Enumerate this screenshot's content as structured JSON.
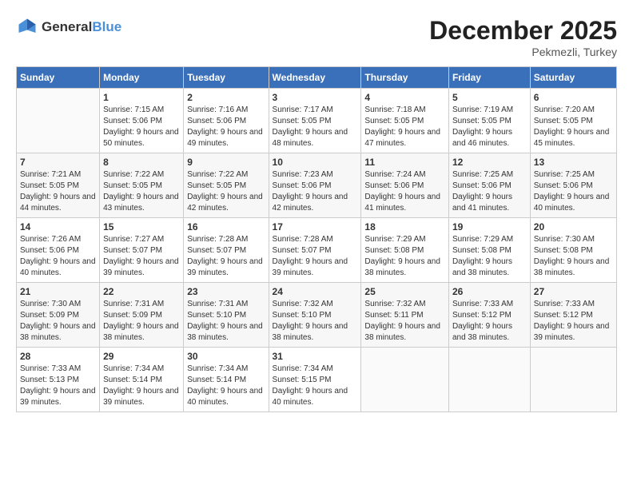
{
  "logo": {
    "general": "General",
    "blue": "Blue"
  },
  "title": "December 2025",
  "location": "Pekmezli, Turkey",
  "days_header": [
    "Sunday",
    "Monday",
    "Tuesday",
    "Wednesday",
    "Thursday",
    "Friday",
    "Saturday"
  ],
  "weeks": [
    [
      {
        "day": "",
        "sunrise": "",
        "sunset": "",
        "daylight": ""
      },
      {
        "day": "1",
        "sunrise": "Sunrise: 7:15 AM",
        "sunset": "Sunset: 5:06 PM",
        "daylight": "Daylight: 9 hours and 50 minutes."
      },
      {
        "day": "2",
        "sunrise": "Sunrise: 7:16 AM",
        "sunset": "Sunset: 5:06 PM",
        "daylight": "Daylight: 9 hours and 49 minutes."
      },
      {
        "day": "3",
        "sunrise": "Sunrise: 7:17 AM",
        "sunset": "Sunset: 5:05 PM",
        "daylight": "Daylight: 9 hours and 48 minutes."
      },
      {
        "day": "4",
        "sunrise": "Sunrise: 7:18 AM",
        "sunset": "Sunset: 5:05 PM",
        "daylight": "Daylight: 9 hours and 47 minutes."
      },
      {
        "day": "5",
        "sunrise": "Sunrise: 7:19 AM",
        "sunset": "Sunset: 5:05 PM",
        "daylight": "Daylight: 9 hours and 46 minutes."
      },
      {
        "day": "6",
        "sunrise": "Sunrise: 7:20 AM",
        "sunset": "Sunset: 5:05 PM",
        "daylight": "Daylight: 9 hours and 45 minutes."
      }
    ],
    [
      {
        "day": "7",
        "sunrise": "Sunrise: 7:21 AM",
        "sunset": "Sunset: 5:05 PM",
        "daylight": "Daylight: 9 hours and 44 minutes."
      },
      {
        "day": "8",
        "sunrise": "Sunrise: 7:22 AM",
        "sunset": "Sunset: 5:05 PM",
        "daylight": "Daylight: 9 hours and 43 minutes."
      },
      {
        "day": "9",
        "sunrise": "Sunrise: 7:22 AM",
        "sunset": "Sunset: 5:05 PM",
        "daylight": "Daylight: 9 hours and 42 minutes."
      },
      {
        "day": "10",
        "sunrise": "Sunrise: 7:23 AM",
        "sunset": "Sunset: 5:06 PM",
        "daylight": "Daylight: 9 hours and 42 minutes."
      },
      {
        "day": "11",
        "sunrise": "Sunrise: 7:24 AM",
        "sunset": "Sunset: 5:06 PM",
        "daylight": "Daylight: 9 hours and 41 minutes."
      },
      {
        "day": "12",
        "sunrise": "Sunrise: 7:25 AM",
        "sunset": "Sunset: 5:06 PM",
        "daylight": "Daylight: 9 hours and 41 minutes."
      },
      {
        "day": "13",
        "sunrise": "Sunrise: 7:25 AM",
        "sunset": "Sunset: 5:06 PM",
        "daylight": "Daylight: 9 hours and 40 minutes."
      }
    ],
    [
      {
        "day": "14",
        "sunrise": "Sunrise: 7:26 AM",
        "sunset": "Sunset: 5:06 PM",
        "daylight": "Daylight: 9 hours and 40 minutes."
      },
      {
        "day": "15",
        "sunrise": "Sunrise: 7:27 AM",
        "sunset": "Sunset: 5:07 PM",
        "daylight": "Daylight: 9 hours and 39 minutes."
      },
      {
        "day": "16",
        "sunrise": "Sunrise: 7:28 AM",
        "sunset": "Sunset: 5:07 PM",
        "daylight": "Daylight: 9 hours and 39 minutes."
      },
      {
        "day": "17",
        "sunrise": "Sunrise: 7:28 AM",
        "sunset": "Sunset: 5:07 PM",
        "daylight": "Daylight: 9 hours and 39 minutes."
      },
      {
        "day": "18",
        "sunrise": "Sunrise: 7:29 AM",
        "sunset": "Sunset: 5:08 PM",
        "daylight": "Daylight: 9 hours and 38 minutes."
      },
      {
        "day": "19",
        "sunrise": "Sunrise: 7:29 AM",
        "sunset": "Sunset: 5:08 PM",
        "daylight": "Daylight: 9 hours and 38 minutes."
      },
      {
        "day": "20",
        "sunrise": "Sunrise: 7:30 AM",
        "sunset": "Sunset: 5:08 PM",
        "daylight": "Daylight: 9 hours and 38 minutes."
      }
    ],
    [
      {
        "day": "21",
        "sunrise": "Sunrise: 7:30 AM",
        "sunset": "Sunset: 5:09 PM",
        "daylight": "Daylight: 9 hours and 38 minutes."
      },
      {
        "day": "22",
        "sunrise": "Sunrise: 7:31 AM",
        "sunset": "Sunset: 5:09 PM",
        "daylight": "Daylight: 9 hours and 38 minutes."
      },
      {
        "day": "23",
        "sunrise": "Sunrise: 7:31 AM",
        "sunset": "Sunset: 5:10 PM",
        "daylight": "Daylight: 9 hours and 38 minutes."
      },
      {
        "day": "24",
        "sunrise": "Sunrise: 7:32 AM",
        "sunset": "Sunset: 5:10 PM",
        "daylight": "Daylight: 9 hours and 38 minutes."
      },
      {
        "day": "25",
        "sunrise": "Sunrise: 7:32 AM",
        "sunset": "Sunset: 5:11 PM",
        "daylight": "Daylight: 9 hours and 38 minutes."
      },
      {
        "day": "26",
        "sunrise": "Sunrise: 7:33 AM",
        "sunset": "Sunset: 5:12 PM",
        "daylight": "Daylight: 9 hours and 38 minutes."
      },
      {
        "day": "27",
        "sunrise": "Sunrise: 7:33 AM",
        "sunset": "Sunset: 5:12 PM",
        "daylight": "Daylight: 9 hours and 39 minutes."
      }
    ],
    [
      {
        "day": "28",
        "sunrise": "Sunrise: 7:33 AM",
        "sunset": "Sunset: 5:13 PM",
        "daylight": "Daylight: 9 hours and 39 minutes."
      },
      {
        "day": "29",
        "sunrise": "Sunrise: 7:34 AM",
        "sunset": "Sunset: 5:14 PM",
        "daylight": "Daylight: 9 hours and 39 minutes."
      },
      {
        "day": "30",
        "sunrise": "Sunrise: 7:34 AM",
        "sunset": "Sunset: 5:14 PM",
        "daylight": "Daylight: 9 hours and 40 minutes."
      },
      {
        "day": "31",
        "sunrise": "Sunrise: 7:34 AM",
        "sunset": "Sunset: 5:15 PM",
        "daylight": "Daylight: 9 hours and 40 minutes."
      },
      {
        "day": "",
        "sunrise": "",
        "sunset": "",
        "daylight": ""
      },
      {
        "day": "",
        "sunrise": "",
        "sunset": "",
        "daylight": ""
      },
      {
        "day": "",
        "sunrise": "",
        "sunset": "",
        "daylight": ""
      }
    ]
  ]
}
